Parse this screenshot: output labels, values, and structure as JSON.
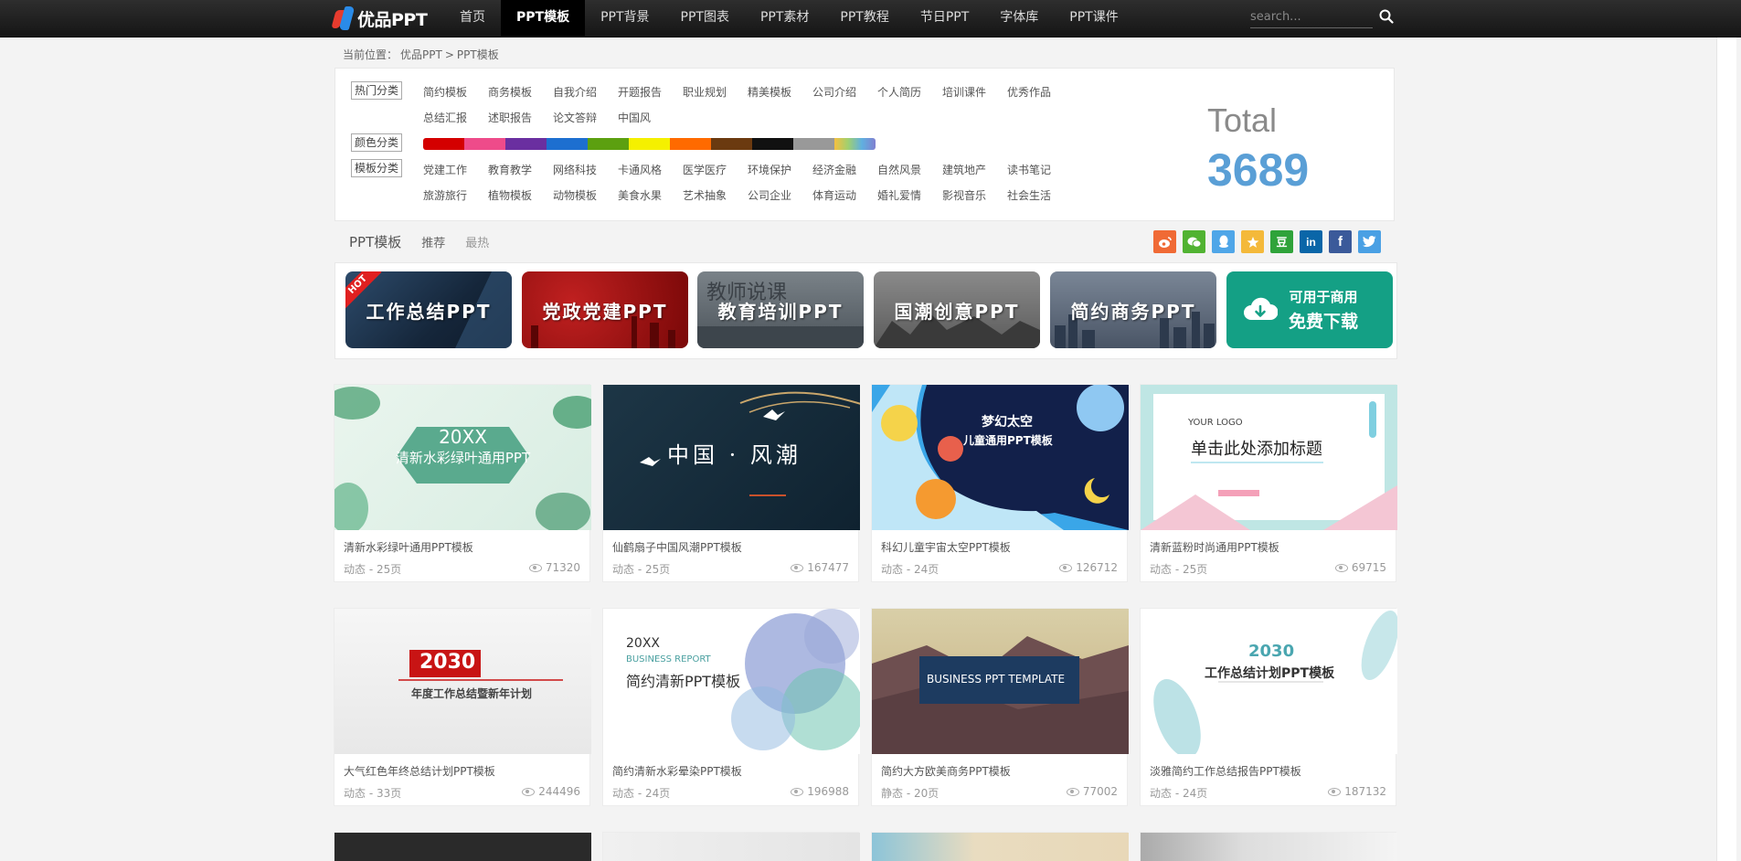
{
  "header": {
    "logo_text": "优品PPT",
    "nav": [
      {
        "label": "首页",
        "active": false
      },
      {
        "label": "PPT模板",
        "active": true
      },
      {
        "label": "PPT背景",
        "active": false
      },
      {
        "label": "PPT图表",
        "active": false
      },
      {
        "label": "PPT素材",
        "active": false
      },
      {
        "label": "PPT教程",
        "active": false
      },
      {
        "label": "节日PPT",
        "active": false
      },
      {
        "label": "字体库",
        "active": false
      },
      {
        "label": "PPT课件",
        "active": false
      }
    ],
    "search_placeholder": "search..."
  },
  "breadcrumb": {
    "prefix": "当前位置：",
    "home": "优品PPT",
    "sep": ">",
    "current": "PPT模板"
  },
  "filters": {
    "hot_tag": "热门分类",
    "hot_row1": [
      "简约模板",
      "商务模板",
      "自我介绍",
      "开题报告",
      "职业规划",
      "精美模板",
      "公司介绍",
      "个人简历",
      "培训课件",
      "优秀作品"
    ],
    "hot_row2": [
      "总结汇报",
      "述职报告",
      "论文答辩",
      "中国风"
    ],
    "color_tag": "颜色分类",
    "colors": [
      "#d40000",
      "#ee4b8a",
      "#6a2fa0",
      "#1d6fd0",
      "#5ca010",
      "#f5f000",
      "#ff6a00",
      "#6b3a10",
      "#111111",
      "#999999",
      "rainbow"
    ],
    "tpl_tag": "模板分类",
    "tpl_row1": [
      "党建工作",
      "教育教学",
      "网络科技",
      "卡通风格",
      "医学医疗",
      "环境保护",
      "经济金融",
      "自然风景",
      "建筑地产",
      "读书笔记"
    ],
    "tpl_row2": [
      "旅游旅行",
      "植物模板",
      "动物模板",
      "美食水果",
      "艺术抽象",
      "公司企业",
      "体育运动",
      "婚礼爱情",
      "影视音乐",
      "社会生活"
    ],
    "total_label": "Total",
    "total_value": "3689"
  },
  "tabs": {
    "main": "PPT模板",
    "recommend": "推荐",
    "hottest": "最热"
  },
  "share": [
    {
      "icon": "weibo-icon",
      "color": "#f06a35"
    },
    {
      "icon": "wechat-icon",
      "color": "#51b332"
    },
    {
      "icon": "qq-icon",
      "color": "#4fa6e8"
    },
    {
      "icon": "qzone-icon",
      "color": "#f4b93a"
    },
    {
      "icon": "douban-icon",
      "color": "#2fa33a",
      "glyph": "豆"
    },
    {
      "icon": "linkedin-icon",
      "color": "#0a66a8",
      "glyph": "in"
    },
    {
      "icon": "facebook-icon",
      "color": "#3b5a9a",
      "glyph": "f"
    },
    {
      "icon": "twitter-icon",
      "color": "#4aa0e4"
    }
  ],
  "banners": [
    {
      "label": "工作总结PPT",
      "hot": "HOT"
    },
    {
      "label": "党政党建PPT"
    },
    {
      "label": "教育培训PPT"
    },
    {
      "label": "国潮创意PPT"
    },
    {
      "label": "简约商务PPT"
    },
    {
      "label_line1": "可用于商用",
      "label_line2": "免费下载"
    }
  ],
  "cards": [
    {
      "title": "清新水彩绿叶通用PPT模板",
      "meta": "动态 - 25页",
      "views": "71320",
      "thumb_line1": "20XX",
      "thumb_line2": "清新水彩绿叶通用PPT"
    },
    {
      "title": "仙鹤扇子中国风潮PPT模板",
      "meta": "动态 - 25页",
      "views": "167477",
      "thumb_line1": "中国 · 风潮"
    },
    {
      "title": "科幻儿童宇宙太空PPT模板",
      "meta": "动态 - 24页",
      "views": "126712",
      "thumb_line1": "梦幻太空",
      "thumb_line2": "儿童通用PPT模板"
    },
    {
      "title": "清新蓝粉时尚通用PPT模板",
      "meta": "动态 - 25页",
      "views": "69715",
      "thumb_line1": "YOUR LOGO",
      "thumb_line2": "单击此处添加标题"
    },
    {
      "title": "大气红色年终总结计划PPT模板",
      "meta": "动态 - 33页",
      "views": "244496",
      "thumb_line1": "2030",
      "thumb_line2": "年度工作总结暨新年计划"
    },
    {
      "title": "简约清新水彩晕染PPT模板",
      "meta": "动态 - 24页",
      "views": "196988",
      "thumb_line1": "20XX",
      "thumb_line2": "BUSINESS REPORT",
      "thumb_line3": "简约清新PPT模板"
    },
    {
      "title": "简约大方欧美商务PPT模板",
      "meta": "静态 - 20页",
      "views": "77002",
      "thumb_line1": "BUSINESS PPT TEMPLATE"
    },
    {
      "title": "淡雅简约工作总结报告PPT模板",
      "meta": "动态 - 24页",
      "views": "187132",
      "thumb_line1": "2030",
      "thumb_line2": "工作总结计划PPT模板"
    }
  ]
}
